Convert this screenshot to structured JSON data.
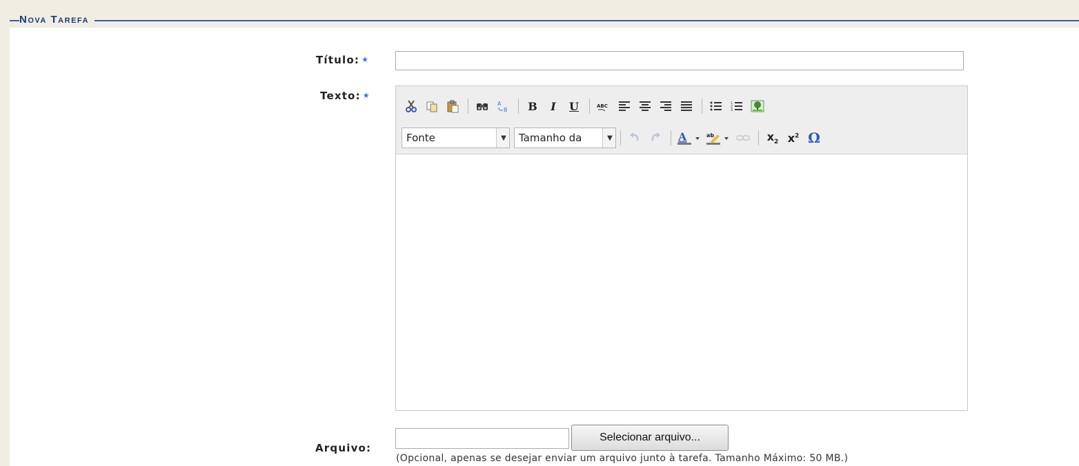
{
  "section": {
    "title": "Nova Tarefa"
  },
  "form": {
    "titulo_label": "Título:",
    "texto_label": "Texto:",
    "arquivo_label": "Arquivo:",
    "required_mark": "★",
    "titulo_value": "",
    "texto_value": "",
    "file_button_label": "Selecionar arquivo...",
    "file_hint": "(Opcional, apenas se desejar enviar um arquivo junto à tarefa. Tamanho Máximo: 50 MB.)"
  },
  "editor": {
    "font_combo": "Fonte",
    "size_combo": "Tamanho da",
    "toolbar_row1": [
      "cut-icon",
      "copy-icon",
      "paste-icon",
      "find-icon",
      "replace-icon",
      "bold-icon",
      "italic-icon",
      "underline-icon",
      "spellcheck-icon",
      "align-left-icon",
      "align-center-icon",
      "align-right-icon",
      "justify-icon",
      "bullet-list-icon",
      "numbered-list-icon",
      "image-icon"
    ],
    "toolbar_row2": [
      "undo-icon",
      "redo-icon",
      "text-color-icon",
      "highlight-icon",
      "link-icon",
      "subscript-icon",
      "superscript-icon",
      "special-char-icon"
    ]
  },
  "colors": {
    "header_text": "#1c3a78",
    "header_line": "#3a5ca0",
    "required_star": "#3b6fd4",
    "page_bg": "#f0ede2"
  }
}
